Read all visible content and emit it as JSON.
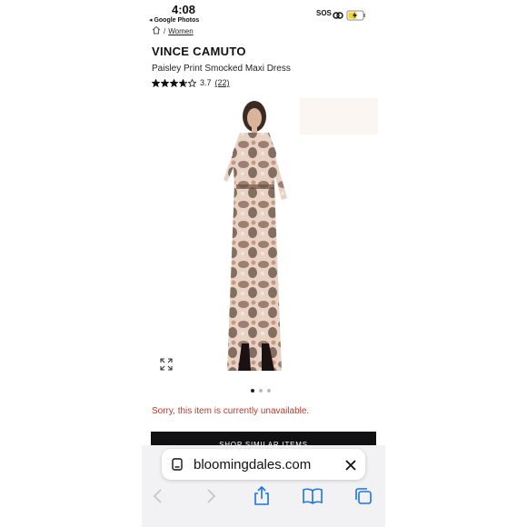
{
  "status_bar": {
    "time": "4:08",
    "back_app": "◂ Google Photos",
    "sos": "SOS"
  },
  "breadcrumb": {
    "separator": "/",
    "category": "Women"
  },
  "product": {
    "brand": "VINCE CAMUTO",
    "name": "Paisley Print Smocked Maxi Dress",
    "rating": "3.7",
    "rating_value": 3.7,
    "review_count": "(22)",
    "unavailable_message": "Sorry, this item is currently unavailable.",
    "cta_label": "SHOP SIMILAR ITEMS"
  },
  "carousel": {
    "total": 3,
    "active_index": 0
  },
  "browser": {
    "url": "bloomingdales.com"
  },
  "colors": {
    "error": "#c0392b",
    "cta_bg": "#111111",
    "link_blue": "#1a73e8"
  }
}
